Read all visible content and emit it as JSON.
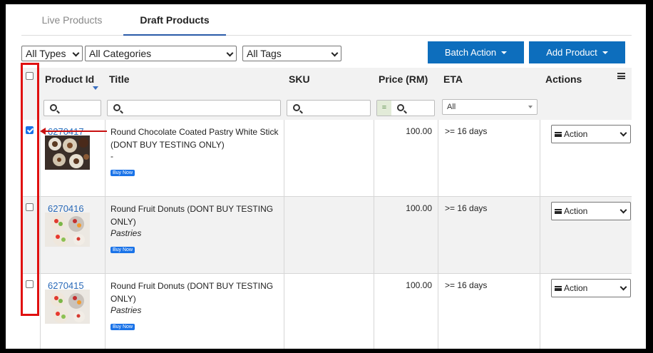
{
  "tabs": [
    {
      "label": "Live Products",
      "active": false
    },
    {
      "label": "Draft Products",
      "active": true
    }
  ],
  "filters": {
    "types": "All Types",
    "categories": "All Categories",
    "tags": "All Tags"
  },
  "buttons": {
    "batch_action": "Batch Action",
    "add_product": "Add Product"
  },
  "columns": {
    "product_id": "Product Id",
    "title": "Title",
    "sku": "SKU",
    "price": "Price (RM)",
    "eta": "ETA",
    "actions": "Actions"
  },
  "column_filters": {
    "price_operator": "=",
    "eta_value": "All"
  },
  "rows": [
    {
      "id": "6270417",
      "checked": true,
      "title": "Round Chocolate Coated Pastry White Stick (DONT BUY TESTING ONLY)",
      "category": "-",
      "badge": "Buy Now",
      "price": "100.00",
      "eta": ">= 16 days",
      "action": "Action"
    },
    {
      "id": "6270416",
      "checked": false,
      "title": "Round Fruit Donuts (DONT BUY TESTING ONLY)",
      "category": "Pastries",
      "badge": "Buy Now",
      "price": "100.00",
      "eta": ">= 16 days",
      "action": "Action"
    },
    {
      "id": "6270415",
      "checked": false,
      "title": "Round Fruit Donuts (DONT BUY TESTING ONLY)",
      "category": "Pastries",
      "badge": "Buy Now",
      "price": "100.00",
      "eta": ">= 16 days",
      "action": "Action"
    }
  ],
  "colors": {
    "primary_button": "#0d6ebd",
    "link": "#2a6ab8",
    "annotation": "#e01010"
  }
}
